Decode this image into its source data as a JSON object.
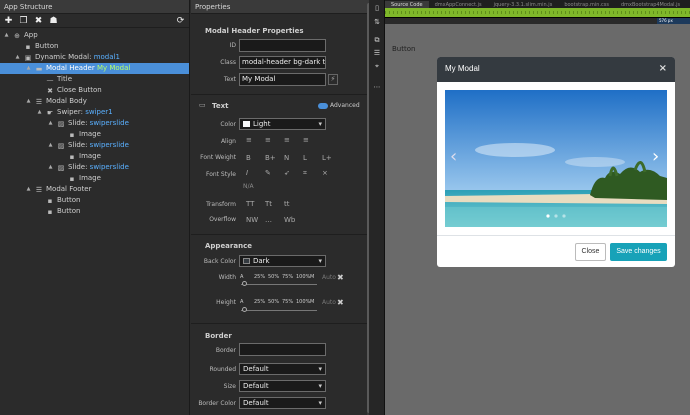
{
  "left_panel": {
    "title": "App Structure",
    "tree": [
      {
        "label": "App",
        "indent": 0,
        "icon": "globe-icon",
        "tw": "▲",
        "blue": ""
      },
      {
        "label": "Button",
        "indent": 1,
        "icon": "box-icon",
        "tw": "",
        "blue": ""
      },
      {
        "label": "Dynamic Modal: ",
        "blue": "modal1",
        "indent": 1,
        "icon": "window-icon",
        "tw": "▲"
      },
      {
        "label": "Modal Header ",
        "blue": "My Modal",
        "indent": 2,
        "icon": "header-icon",
        "tw": "▲",
        "sel": true
      },
      {
        "label": "Title",
        "indent": 3,
        "icon": "dash-icon",
        "tw": "",
        "blue": ""
      },
      {
        "label": "Close Button",
        "indent": 3,
        "icon": "x-icon",
        "tw": "",
        "blue": ""
      },
      {
        "label": "Modal Body",
        "indent": 2,
        "icon": "list-icon",
        "tw": "▲",
        "blue": ""
      },
      {
        "label": "Swiper: ",
        "blue": "swiper1",
        "indent": 3,
        "icon": "hand-icon",
        "tw": "▲"
      },
      {
        "label": "Slide: ",
        "blue": "swiperslide",
        "indent": 4,
        "icon": "image-icon",
        "tw": "▲"
      },
      {
        "label": "Image",
        "indent": 5,
        "icon": "box-icon",
        "tw": "",
        "blue": ""
      },
      {
        "label": "Slide: ",
        "blue": "swiperslide",
        "indent": 4,
        "icon": "image-icon",
        "tw": "▲"
      },
      {
        "label": "Image",
        "indent": 5,
        "icon": "box-icon",
        "tw": "",
        "blue": ""
      },
      {
        "label": "Slide: ",
        "blue": "swiperslide",
        "indent": 4,
        "icon": "image-icon",
        "tw": "▲"
      },
      {
        "label": "Image",
        "indent": 5,
        "icon": "box-icon",
        "tw": "",
        "blue": ""
      },
      {
        "label": "Modal Footer",
        "indent": 2,
        "icon": "list-icon",
        "tw": "▲",
        "blue": ""
      },
      {
        "label": "Button",
        "indent": 3,
        "icon": "box-icon",
        "tw": "",
        "blue": ""
      },
      {
        "label": "Button",
        "indent": 3,
        "icon": "box-icon",
        "tw": "",
        "blue": ""
      }
    ]
  },
  "props": {
    "title": "Properties",
    "section1": "Modal Header Properties",
    "id_label": "ID",
    "id_value": "",
    "class_label": "Class",
    "class_value": "modal-header bg-dark tex",
    "text_label": "Text",
    "text_value": "My Modal",
    "text_section": "Text",
    "advanced": "Advanced",
    "color_label": "Color",
    "color_value": "Light",
    "align_label": "Align",
    "weight_label": "Font Weight",
    "weights": [
      "B",
      "B+",
      "N",
      "L",
      "L+"
    ],
    "style_label": "Font Style",
    "na": "N/A",
    "transform_label": "Transform",
    "transforms": [
      "TT",
      "Tt",
      "tt"
    ],
    "overflow_label": "Overflow",
    "overflows": [
      "NW",
      "…",
      "Wb"
    ],
    "appearance": "Appearance",
    "back_color_label": "Back Color",
    "back_color_value": "Dark",
    "width_label": "Width",
    "height_label": "Height",
    "sizes": [
      "A",
      "25%",
      "50%",
      "75%",
      "100%",
      "M"
    ],
    "auto": "Auto",
    "border_section": "Border",
    "border_label": "Border",
    "border_value": "",
    "rounded_label": "Rounded",
    "rounded_value": "Default",
    "size_label": "Size",
    "size_value": "Default",
    "bcolor_label": "Border Color",
    "bcolor_value": "Default"
  },
  "preview": {
    "file_tabs": [
      "Source Code",
      "dmxAppConnect.js",
      "jquery-3.3.1.slim.min.js",
      "bootstrap.min.css",
      "dmxBootstrap4Modal.js",
      "dmxSwiper.js"
    ],
    "ruler": "576 px",
    "button_text": "Button",
    "modal_title": "My Modal",
    "close_symbol": "×",
    "close_btn": "Close",
    "save_btn": "Save changes"
  }
}
